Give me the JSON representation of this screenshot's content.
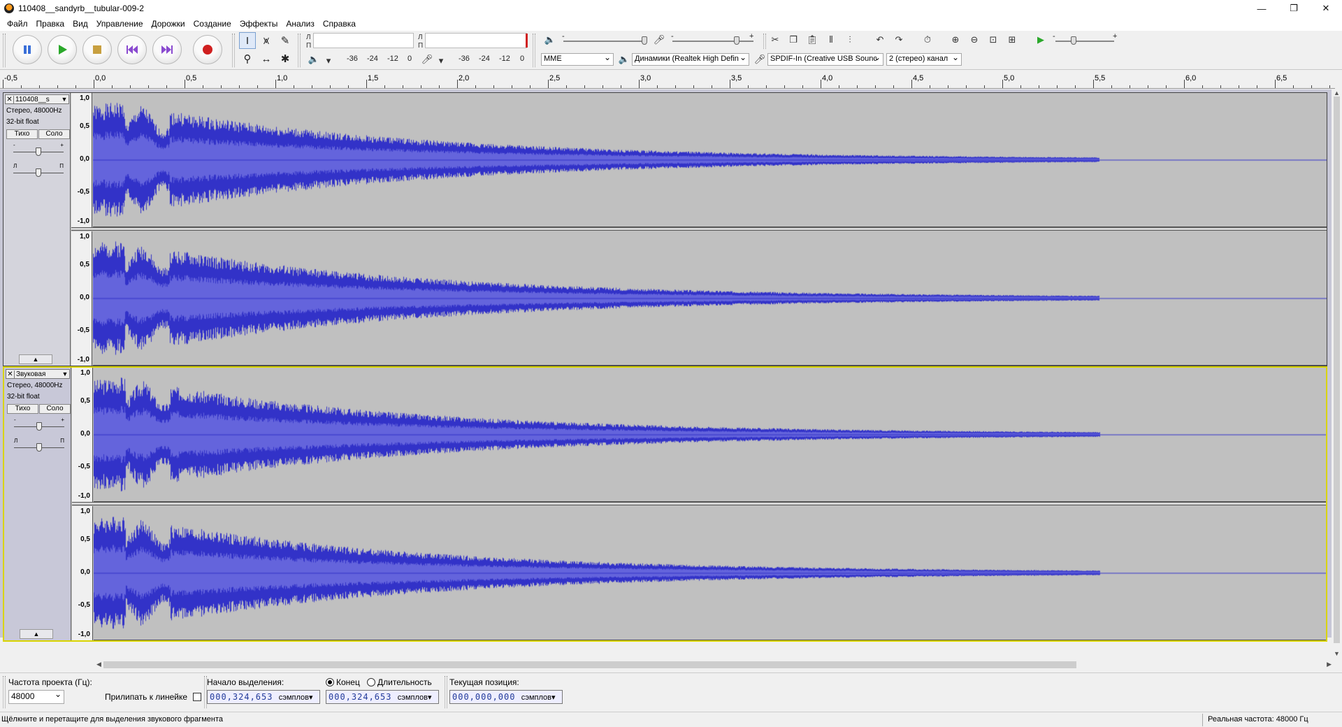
{
  "window": {
    "title": "110408__sandyrb__tubular-009-2",
    "controls": [
      "—",
      "❐",
      "✕"
    ]
  },
  "menu": [
    "Файл",
    "Правка",
    "Вид",
    "Управление",
    "Дорожки",
    "Создание",
    "Эффекты",
    "Анализ",
    "Справка"
  ],
  "transport": {
    "buttons": [
      "pause",
      "play",
      "stop",
      "skip-start",
      "skip-end",
      "record"
    ]
  },
  "meters": {
    "play_channel_l": "Л",
    "play_channel_r": "П",
    "rec_channel_l": "Л",
    "rec_channel_r": "П",
    "scale_play": [
      "-36",
      "-24",
      "-12",
      "0"
    ],
    "scale_rec": [
      "-36",
      "-24",
      "-12",
      "0"
    ],
    "minus": "-",
    "plus": "+"
  },
  "device": {
    "host": "MME",
    "output": "Динамики (Realtek High Defin",
    "input": "SPDIF-In (Creative USB Sounc",
    "channels": "2 (стерео) канал"
  },
  "ruler": {
    "labels": [
      "-0,5",
      "0,0",
      "0,5",
      "1,0",
      "1,5",
      "2,0",
      "2,5",
      "3,0",
      "3,5",
      "4,0",
      "4,5",
      "5,0",
      "5,5",
      "6,0",
      "6,5"
    ]
  },
  "tracks": [
    {
      "name": "110408__s",
      "info1": "Стерео, 48000Hz",
      "info2": "32-bit float",
      "mute": "Тихо",
      "solo": "Соло",
      "gain_minus": "-",
      "gain_plus": "+",
      "pan_left": "Л",
      "pan_right": "П",
      "scale": [
        "1,0",
        "0,5",
        "0,0",
        "-0,5",
        "-1,0"
      ]
    },
    {
      "name": "Звуковая",
      "info1": "Стерео, 48000Hz",
      "info2": "32-bit float",
      "mute": "Тихо",
      "solo": "Соло",
      "gain_minus": "-",
      "gain_plus": "+",
      "pan_left": "Л",
      "pan_right": "П",
      "scale": [
        "1,0",
        "0,5",
        "0,0",
        "-0,5",
        "-1,0"
      ]
    }
  ],
  "colors": {
    "waveform": "#3232c8",
    "waveform_rms": "#6464dc",
    "track_bg": "#c0c0c0",
    "selection_border": "#d9d400"
  },
  "selection_bar": {
    "rate_label": "Частота проекта (Гц):",
    "rate_value": "48000",
    "snap_label": "Прилипать к линейке",
    "start_label": "Начало выделения:",
    "start_value": "000,324,653",
    "end_label": "Конец",
    "length_label": "Длительность",
    "end_value": "000,324,653",
    "pos_label": "Текущая позиция:",
    "pos_value": "000,000,000",
    "unit": "сэмплов"
  },
  "status": {
    "hint": "Щёлкните и перетащите для выделения звукового фрагмента",
    "rate": "Реальная частота: 48000 Гц"
  }
}
